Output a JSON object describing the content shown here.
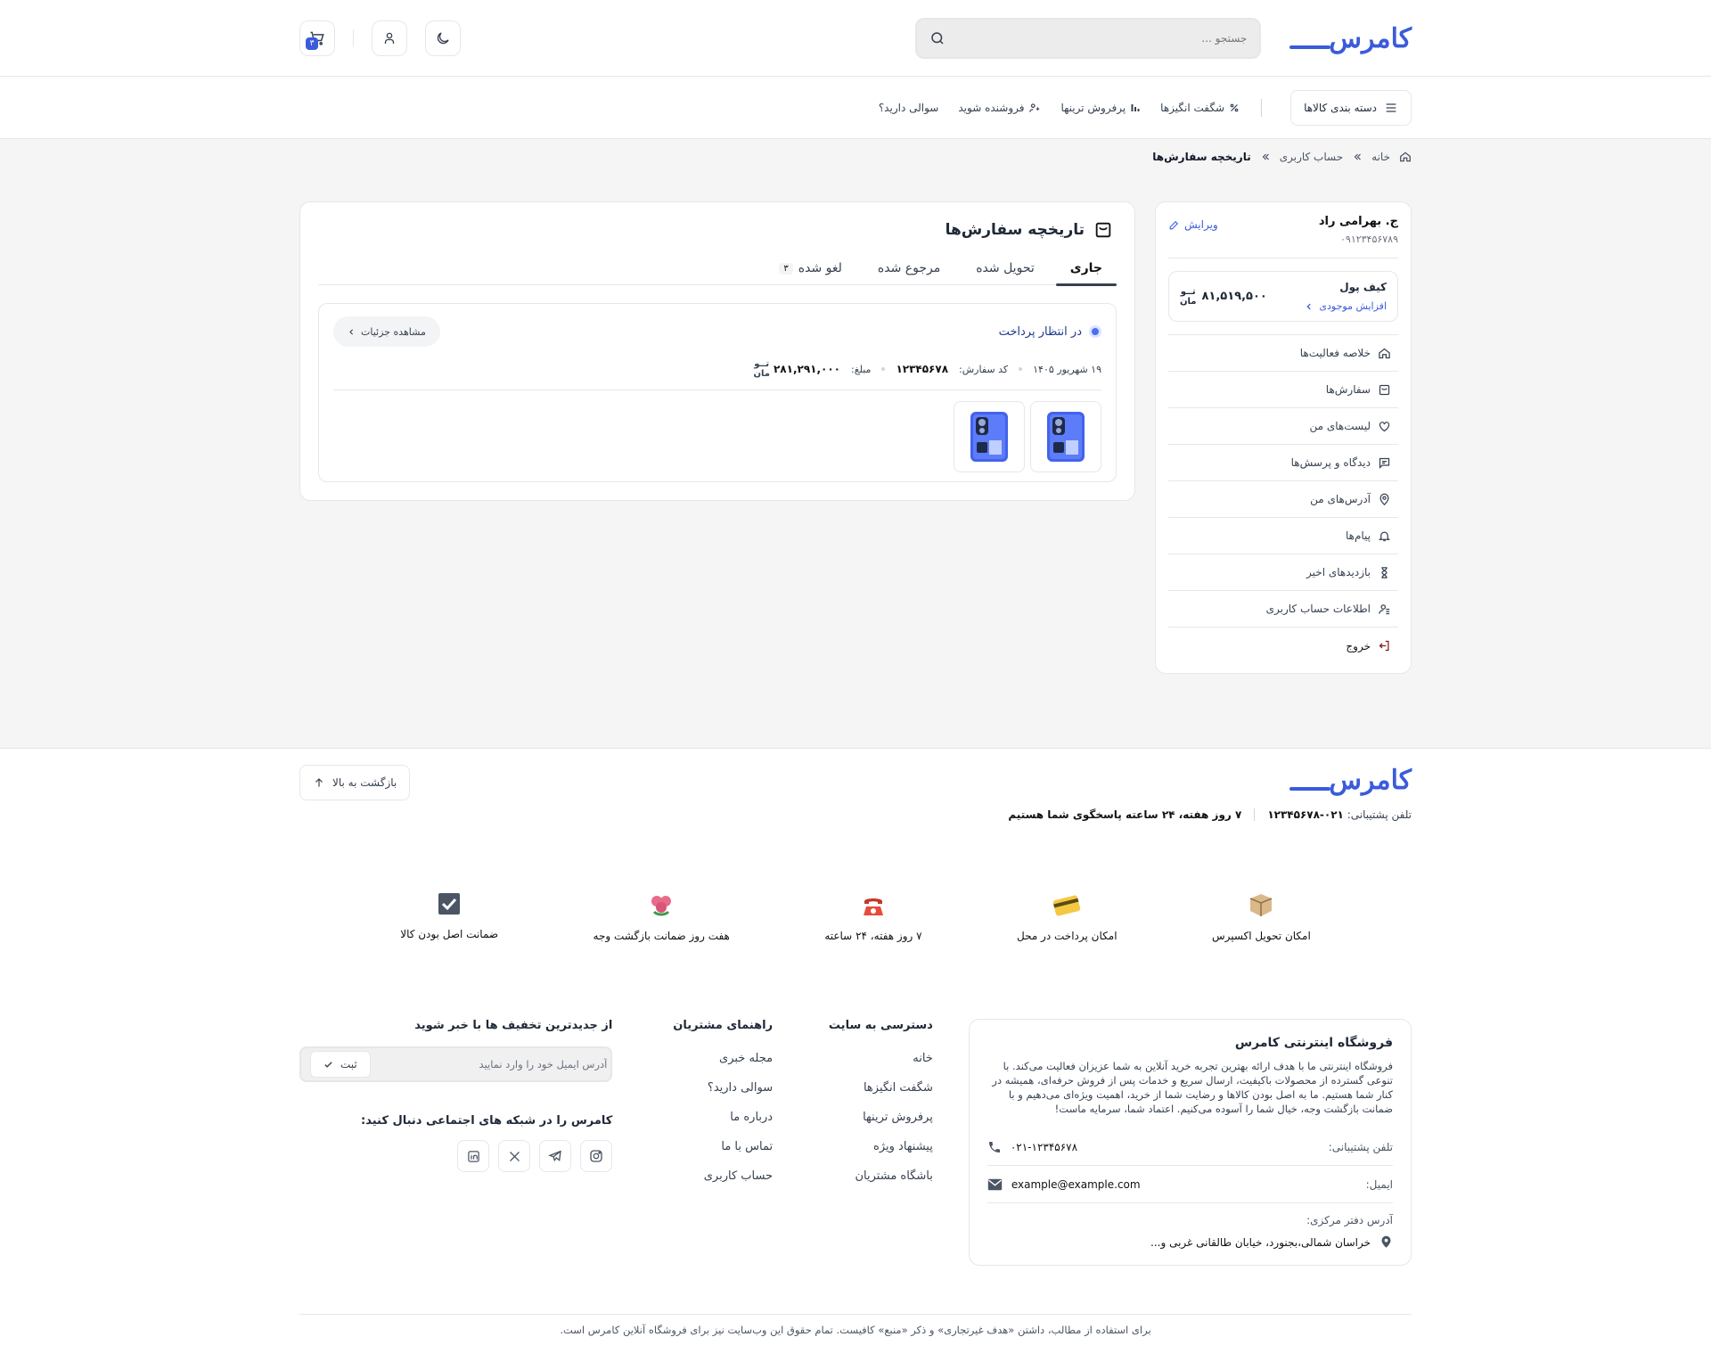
{
  "brand": {
    "logo_text": "کامرس",
    "accent": "#3b5bdb"
  },
  "header": {
    "search_placeholder": "جستجو ...",
    "cart_count": "۳",
    "icons": [
      "search-icon",
      "moon-icon",
      "user-icon",
      "cart-icon"
    ]
  },
  "nav": {
    "categories_label": "دسته بندی کالاها",
    "links": [
      {
        "label": "شگفت انگیزها",
        "icon": "percent-icon"
      },
      {
        "label": "پرفروش ترینها",
        "icon": "chart-icon"
      },
      {
        "label": "فروشنده شوید",
        "icon": "seller-icon"
      },
      {
        "label": "سوالی دارید؟",
        "icon": ""
      }
    ]
  },
  "breadcrumb": {
    "home": "خانه",
    "account": "حساب کاربری",
    "current": "تاریخچه سفارش‌ها"
  },
  "sidebar": {
    "user_name": "ج. بهرامی راد",
    "user_phone": "۰۹۱۲۳۴۵۶۷۸۹",
    "edit_label": "ویرایش",
    "wallet_title": "کیف پول",
    "wallet_action": "افزایش موجودی",
    "wallet_amount": "۸۱,۵۱۹,۵۰۰",
    "currency_top": "تــو",
    "currency_bottom": "مان",
    "menu": [
      {
        "label": "خلاصه فعالیت‌ها",
        "icon": "home-icon"
      },
      {
        "label": "سفارش‌ها",
        "icon": "orders-icon"
      },
      {
        "label": "لیست‌های من",
        "icon": "heart-icon"
      },
      {
        "label": "دیدگاه و پرسش‌ها",
        "icon": "comment-icon"
      },
      {
        "label": "آدرس‌های من",
        "icon": "location-icon"
      },
      {
        "label": "پیام‌ها",
        "icon": "bell-icon"
      },
      {
        "label": "بازدیدهای اخیر",
        "icon": "hourglass-icon"
      },
      {
        "label": "اطلاعات حساب کاربری",
        "icon": "user-info-icon"
      }
    ],
    "logout": "خروج"
  },
  "orders": {
    "title": "تاریخچه سفارش‌ها",
    "tabs": [
      {
        "label": "جاری",
        "active": true
      },
      {
        "label": "تحویل شده"
      },
      {
        "label": "مرجوع شده"
      },
      {
        "label": "لغو شده",
        "count": "۳"
      }
    ],
    "card": {
      "status": "در انتظار پرداخت",
      "details_label": "مشاهده جزئیات",
      "date": "۱۹ شهریور ۱۴۰۵",
      "code_label": "کد سفارش:",
      "code": "۱۲۳۴۵۶۷۸",
      "amount_label": "مبلغ:",
      "amount": "۲۸۱,۲۹۱,۰۰۰",
      "currency_top": "تــو",
      "currency_bottom": "مان"
    }
  },
  "footer": {
    "back_to_top": "بازگشت به بالا",
    "support_label": "تلفن پشتیبانی:",
    "support_phone": "۰۲۱-۱۲۳۴۵۶۷۸",
    "support_hours": "۷ روز هفته، ۲۴ ساعته پاسخگوی شما هستیم",
    "features": [
      {
        "label": "امکان تحویل اکسپرس",
        "icon": "box-icon"
      },
      {
        "label": "امکان پرداخت در محل",
        "icon": "card-icon"
      },
      {
        "label": "۷ روز هفته، ۲۴ ساعته",
        "icon": "phone-icon"
      },
      {
        "label": "هفت روز ضمانت بازگشت وجه",
        "icon": "flower-icon"
      },
      {
        "label": "ضمانت اصل بودن کالا",
        "icon": "check-icon"
      }
    ],
    "about_title": "فروشگاه اینترنتی کامرس",
    "about_text": "فروشگاه اینترنتی ما با هدف ارائه بهترین تجربه خرید آنلاین به شما عزیزان فعالیت می‌کند. با تنوعی گسترده از محصولات باکیفیت، ارسال سریع و خدمات پس از فروش حرفه‌ای، همیشه در کنار شما هستیم. ما به اصل بودن کالاها و رضایت شما از خرید، اهمیت ویژه‌ای می‌دهیم و با ضمانت بازگشت وجه، خیال شما را آسوده می‌کنیم. اعتماد شما، سرمایه ماست!",
    "phone_label": "تلفن پشتیبانی:",
    "phone_value": "۰۲۱-۱۲۳۴۵۶۷۸",
    "email_label": "ایمیل:",
    "email_value": "example@example.com",
    "address_label": "آدرس دفتر مرکزی:",
    "address_value": "خراسان شمالی،بجنورد، خیابان طالقانی غربی و...",
    "col1_title": "دسترسی به سایت",
    "col1_links": [
      "خانه",
      "شگفت انگیزها",
      "پرفروش ترینها",
      "پیشنهاد ویژه",
      "باشگاه مشتریان"
    ],
    "col2_title": "راهنمای مشتریان",
    "col2_links": [
      "مجله خبری",
      "سوالی دارید؟",
      "درباره ما",
      "تماس با ما",
      "حساب کاربری"
    ],
    "news_title": "از جدیدترین تخفیف ها با خبر شوید",
    "news_placeholder": "آدرس ایمیل خود را وارد نمایید",
    "news_submit": "ثبت",
    "social_title": "کامرس را در شبکه های اجتماعی دنبال کنید:",
    "socials": [
      "instagram-icon",
      "telegram-icon",
      "x-icon",
      "linkedin-icon"
    ],
    "copyright": "برای استفاده از مطالب، داشتن «هدف غیرتجاری» و ذکر «منبع» کافیست. تمام حقوق این وب‌سایت نیز برای فروشگاه آنلاین کامرس است."
  }
}
